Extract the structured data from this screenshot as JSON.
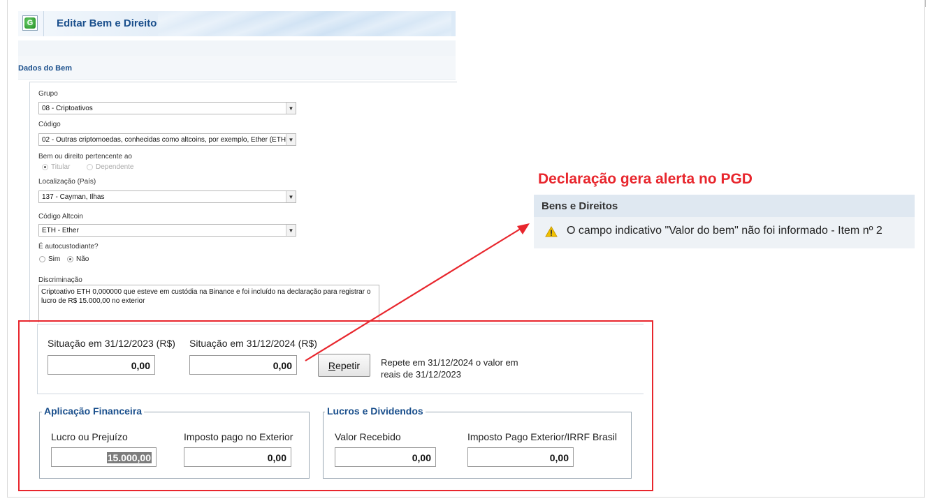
{
  "header": {
    "title": "Editar Bem e Direito",
    "logo_letter": "G"
  },
  "section": {
    "title": "Dados do Bem"
  },
  "form": {
    "grupo": {
      "label": "Grupo",
      "value": "08 - Criptoativos"
    },
    "codigo": {
      "label": "Código",
      "value": "02 - Outras criptomoedas, conhecidas como altcoins, por exemplo, Ether (ETH"
    },
    "pertencente": {
      "label": "Bem ou direito pertencente ao",
      "options": [
        "Titular",
        "Dependente"
      ],
      "selected": "Titular"
    },
    "localizacao": {
      "label": "Localização (País)",
      "value": "137 - Cayman, Ilhas"
    },
    "altcoin": {
      "label": "Código Altcoin",
      "value": "ETH - Ether"
    },
    "autocustodiante": {
      "label": "É autocustodiante?",
      "options": [
        "Sim",
        "Não"
      ],
      "selected": "Não"
    },
    "discriminacao": {
      "label": "Discriminação",
      "value": "Criptoativo ETH 0,000000 que esteve em custódia na Binance e foi incluído na declaração para registrar o lucro de R$ 15.000,00 no exterior"
    }
  },
  "situacao": {
    "label_2023": "Situação em 31/12/2023 (R$)",
    "value_2023": "0,00",
    "label_2024": "Situação em 31/12/2024 (R$)",
    "value_2024": "0,00",
    "repetir_rest": "epetir",
    "repetir_key": "R",
    "repete_text": "Repete em 31/12/2024 o valor em reais de 31/12/2023"
  },
  "aplicacao": {
    "legend": "Aplicação Financeira",
    "lucro_label": "Lucro ou Prejuízo",
    "lucro_value": "15.000,00",
    "imposto_label": "Imposto pago no Exterior",
    "imposto_value": "0,00"
  },
  "lucros": {
    "legend": "Lucros e Dividendos",
    "valor_label": "Valor Recebido",
    "valor_value": "0,00",
    "imposto_label": "Imposto Pago Exterior/IRRF Brasil",
    "imposto_value": "0,00"
  },
  "alert": {
    "title": "Declaração gera alerta no PGD",
    "section": "Bens e Direitos",
    "message": "O campo indicativo \"Valor do bem\" não foi informado - Item nº 2",
    "icon": "warning-icon"
  },
  "colors": {
    "accent_red": "#e8262d",
    "title_blue": "#1a4f8c",
    "warning_yellow": "#f2c200"
  }
}
